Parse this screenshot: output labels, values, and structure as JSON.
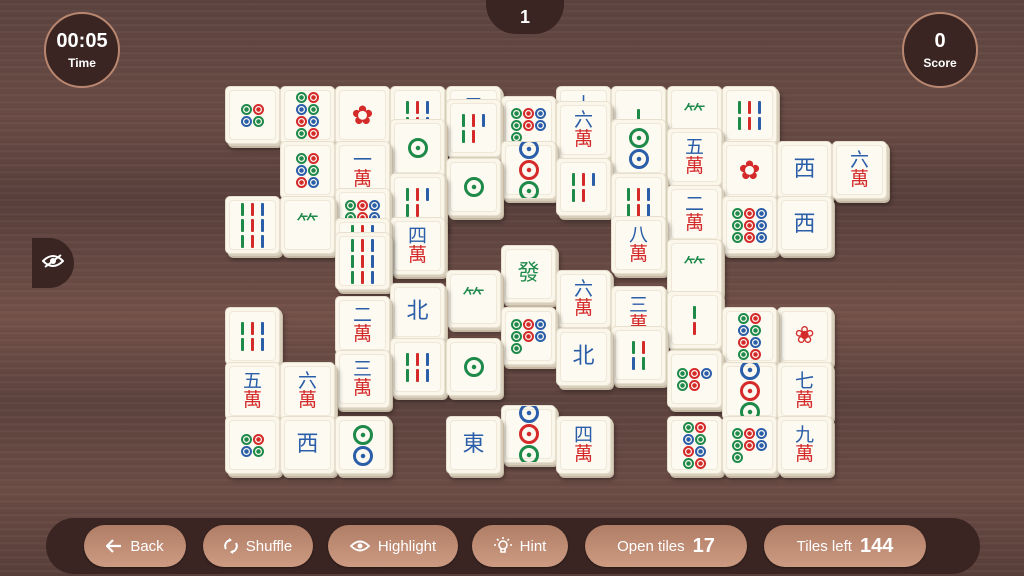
{
  "hud": {
    "time_value": "00:05",
    "time_label": "Time",
    "score_value": "0",
    "score_label": "Score",
    "level": "1"
  },
  "toolbar": {
    "back_label": "Back",
    "shuffle_label": "Shuffle",
    "highlight_label": "Highlight",
    "hint_label": "Hint",
    "open_tiles_label": "Open tiles",
    "open_tiles_value": "17",
    "tiles_left_label": "Tiles left",
    "tiles_left_value": "144"
  },
  "colors": {
    "panel": "#3a2522",
    "pill": "#c4917a",
    "tile_face": "#fbf6ea",
    "char_blue": "#2b5ea8",
    "char_red": "#d42a2a",
    "char_green": "#1e8a4a"
  },
  "tiles": [
    {
      "face": "dots-4"
    },
    {
      "face": "dots-8"
    },
    {
      "face": "flower-chrysanthemum"
    },
    {
      "face": "bamboo-6"
    },
    {
      "face": "characters-2",
      "top": "二"
    },
    {
      "face": "dots-7"
    },
    {
      "face": "characters-10",
      "top": "十"
    },
    {
      "face": "bamboo-1"
    },
    {
      "face": "bamboo-plant"
    },
    {
      "face": "bamboo-6"
    },
    {
      "face": "dots-6"
    },
    {
      "face": "characters-1",
      "top": "一"
    },
    {
      "face": "dots-1"
    },
    {
      "face": "bamboo-5"
    },
    {
      "face": "dots-3"
    },
    {
      "face": "characters-6",
      "top": "六"
    },
    {
      "face": "dots-2"
    },
    {
      "face": "characters-5",
      "top": "五"
    },
    {
      "face": "flower-chrysanthemum"
    },
    {
      "face": "west-wind",
      "top": "西"
    },
    {
      "face": "characters-6",
      "top": "六"
    },
    {
      "face": "bamboo-9"
    },
    {
      "face": "season-bamboo"
    },
    {
      "face": "dots-9"
    },
    {
      "face": "bamboo-5"
    },
    {
      "face": "dots-1"
    },
    {
      "face": "bamboo-5"
    },
    {
      "face": "bamboo-6"
    },
    {
      "face": "characters-2",
      "top": "二"
    },
    {
      "face": "dots-9"
    },
    {
      "face": "west-wind",
      "top": "西"
    },
    {
      "face": "bamboo-9"
    },
    {
      "face": "characters-4",
      "top": "四"
    },
    {
      "face": "characters-8",
      "top": "八"
    },
    {
      "face": "bamboo-plant"
    },
    {
      "face": "green-dragon",
      "top": "發"
    },
    {
      "face": "dots-7"
    },
    {
      "face": "bamboo-9"
    },
    {
      "face": "characters-2",
      "top": "二"
    },
    {
      "face": "north-wind",
      "top": "北"
    },
    {
      "face": "bamboo-plant"
    },
    {
      "face": "characters-6",
      "top": "六"
    },
    {
      "face": "characters-3",
      "top": "三"
    },
    {
      "face": "bamboo-2"
    },
    {
      "face": "bamboo-6"
    },
    {
      "face": "flower-plum"
    },
    {
      "face": "characters-3",
      "top": "三"
    },
    {
      "face": "bamboo-6"
    },
    {
      "face": "dots-1"
    },
    {
      "face": "dots-8"
    },
    {
      "face": "north-wind",
      "top": "北"
    },
    {
      "face": "bamboo-4"
    },
    {
      "face": "dots-5"
    },
    {
      "face": "dots-3"
    },
    {
      "face": "characters-7",
      "top": "七"
    },
    {
      "face": "characters-5",
      "top": "五"
    },
    {
      "face": "characters-6",
      "top": "六"
    },
    {
      "face": "dots-4"
    },
    {
      "face": "west-wind",
      "top": "西"
    },
    {
      "face": "dots-2"
    },
    {
      "face": "east-wind",
      "top": "東"
    },
    {
      "face": "dots-3"
    },
    {
      "face": "characters-4",
      "top": "四"
    },
    {
      "face": "dots-8"
    },
    {
      "face": "dots-7"
    },
    {
      "face": "characters-9",
      "top": "九"
    }
  ]
}
